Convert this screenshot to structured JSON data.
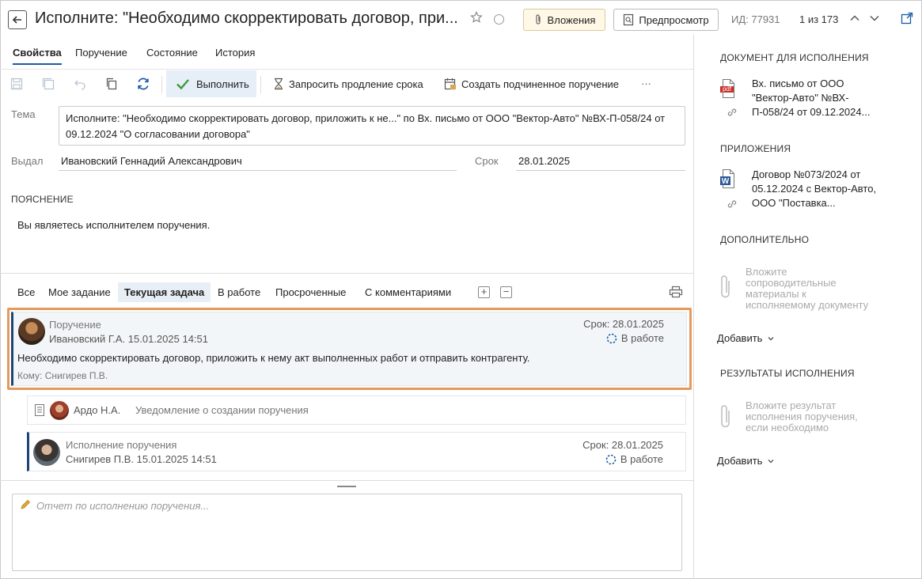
{
  "header": {
    "title": "Исполните: \"Необходимо скорректировать договор, при...",
    "attachments_label": "Вложения",
    "preview_label": "Предпросмотр",
    "id_text": "ИД: 77931",
    "pager_text": "1 из 173"
  },
  "tabs": [
    {
      "label": "Свойства",
      "active": true
    },
    {
      "label": "Поручение",
      "active": false
    },
    {
      "label": "Состояние",
      "active": false
    },
    {
      "label": "История",
      "active": false
    }
  ],
  "toolbar": {
    "execute_label": "Выполнить",
    "extend_label": "Запросить продление срока",
    "create_sub_label": "Создать подчиненное поручение",
    "more_label": "···"
  },
  "form": {
    "subject_label": "Тема",
    "subject_value": "Исполните: \"Необходимо скорректировать договор, приложить к не...\" по Вх. письмо от ООО \"Вектор-Авто\" №ВХ-П-058/24 от 09.12.2024 \"О согласовании договора\"",
    "issued_label": "Выдал",
    "issued_value": "Ивановский Геннадий Александрович",
    "due_label": "Срок",
    "due_value": "28.01.2025",
    "explanation_head": "ПОЯСНЕНИЕ",
    "explanation_text": "Вы являетесь исполнителем поручения."
  },
  "filters": [
    {
      "label": "Все",
      "active": false
    },
    {
      "label": "Мое задание",
      "active": false
    },
    {
      "label": "Текущая задача",
      "active": true
    },
    {
      "label": "В работе",
      "active": false
    },
    {
      "label": "Просроченные",
      "active": false
    },
    {
      "label": "С комментариями",
      "active": false
    }
  ],
  "expand_label": "+",
  "collapse_label": "−",
  "tasks": {
    "main": {
      "type": "Поручение",
      "author": "Ивановский Г.А.  15.01.2025 14:51",
      "due": "Срок: 28.01.2025",
      "status": "В работе",
      "body": "Необходимо скорректировать договор, приложить к нему акт выполненных работ и отправить контрагенту.",
      "to": "Кому: Снигирев П.В."
    },
    "notification": {
      "author": "Ардо Н.А.",
      "text": "Уведомление о создании поручения"
    },
    "sub": {
      "type": "Исполнение поручения",
      "author": "Снигирев П.В.  15.01.2025 14:51",
      "due": "Срок: 28.01.2025",
      "status": "В работе"
    }
  },
  "report": {
    "placeholder": "Отчет по исполнению поручения..."
  },
  "sidebar": {
    "doc_head": "ДОКУМЕНТ ДЛЯ ИСПОЛНЕНИЯ",
    "doc_lines": [
      "Вх. письмо от ООО",
      "\"Вектор-Авто\" №ВХ-",
      "П-058/24 от 09.12.2024..."
    ],
    "doc_icon": "pdf",
    "attach_head": "ПРИЛОЖЕНИЯ",
    "attach_lines": [
      "Договор №073/2024 от",
      "05.12.2024 с Вектор-Авто,",
      "ООО \"Поставка..."
    ],
    "attach_icon": "W",
    "extra_head": "ДОПОЛНИТЕЛЬНО",
    "extra_hint_lines": [
      "Вложите",
      "сопроводительные",
      "материалы к",
      "исполняемому документу"
    ],
    "extra_add": "Добавить",
    "results_head": "РЕЗУЛЬТАТЫ ИСПОЛНЕНИЯ",
    "results_hint_lines": [
      "Вложите результат",
      "исполнения поручения,",
      "если необходимо"
    ],
    "results_add": "Добавить"
  },
  "colors": {
    "accent": "#1a5aa6",
    "highlight": "#e39a5b",
    "execute_bg": "#e6eef8",
    "execute_check": "#3c9b3c",
    "card_border": "#1d4478"
  }
}
